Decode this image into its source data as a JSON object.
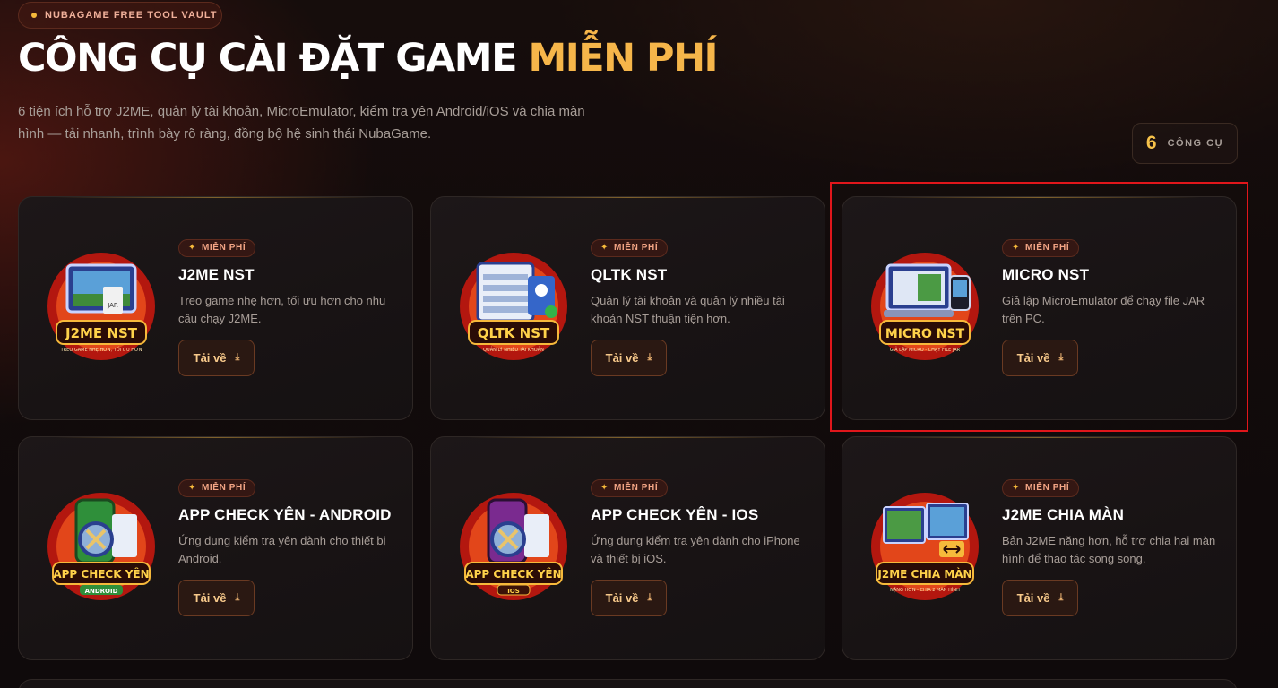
{
  "header": {
    "vault_label": "NUBAGAME FREE TOOL VAULT",
    "title_main": "CÔNG CỤ CÀI ĐẶT GAME ",
    "title_accent": "MIỄN PHÍ",
    "description": "6 tiện ích hỗ trợ J2ME, quản lý tài khoản, MicroEmulator, kiểm tra yên Android/iOS và chia màn hình — tải nhanh, trình bày rõ ràng, đồng bộ hệ sinh thái NubaGame.",
    "count_number": "6",
    "count_label": "CÔNG CỤ"
  },
  "colors": {
    "accent": "#f6b64a",
    "badge_text": "#f3a585",
    "button_text": "#f6c88a",
    "highlight": "#e0161b"
  },
  "tools": [
    {
      "badge": "MIỄN PHÍ",
      "title": "J2ME NST",
      "desc": "Treo game nhẹ hơn, tối ưu hơn cho nhu cầu chạy J2ME.",
      "button": "Tải về",
      "thumb_title": "J2ME NST",
      "thumb_sub": "TREO GAME NHẸ HƠN, TỐI ƯU HƠN",
      "icon": "j2me-nst-icon"
    },
    {
      "badge": "MIỄN PHÍ",
      "title": "QLTK NST",
      "desc": "Quản lý tài khoản và quản lý nhiều tài khoản NST thuận tiện hơn.",
      "button": "Tải về",
      "thumb_title": "QLTK NST",
      "thumb_sub": "QUẢN LÝ NHIỀU TÀI KHOẢN",
      "icon": "qltk-nst-icon"
    },
    {
      "badge": "MIỄN PHÍ",
      "title": "MICRO NST",
      "desc": "Giả lập MicroEmulator để chạy file JAR trên PC.",
      "button": "Tải về",
      "thumb_title": "MICRO NST",
      "thumb_sub": "GIẢ LẬP MICRO - CHẠY FILE JAR",
      "icon": "micro-nst-icon"
    },
    {
      "badge": "MIỄN PHÍ",
      "title": "APP CHECK YÊN - ANDROID",
      "desc": "Ứng dụng kiểm tra yên dành cho thiết bị Android.",
      "button": "Tải về",
      "thumb_title": "APP CHECK YÊN",
      "thumb_sub": "ANDROID",
      "icon": "android-check-icon"
    },
    {
      "badge": "MIỄN PHÍ",
      "title": "APP CHECK YÊN - IOS",
      "desc": "Ứng dụng kiểm tra yên dành cho iPhone và thiết bị iOS.",
      "button": "Tải về",
      "thumb_title": "APP CHECK YÊN",
      "thumb_sub": "IOS",
      "icon": "ios-check-icon"
    },
    {
      "badge": "MIỄN PHÍ",
      "title": "J2ME CHIA MÀN",
      "desc": "Bản J2ME nặng hơn, hỗ trợ chia hai màn hình để thao tác song song.",
      "button": "Tải về",
      "thumb_title": "J2ME CHIA MÀN",
      "thumb_sub": "NẶNG HƠN - CHIA 2 MÀN HÌNH",
      "icon": "split-screen-icon"
    }
  ]
}
